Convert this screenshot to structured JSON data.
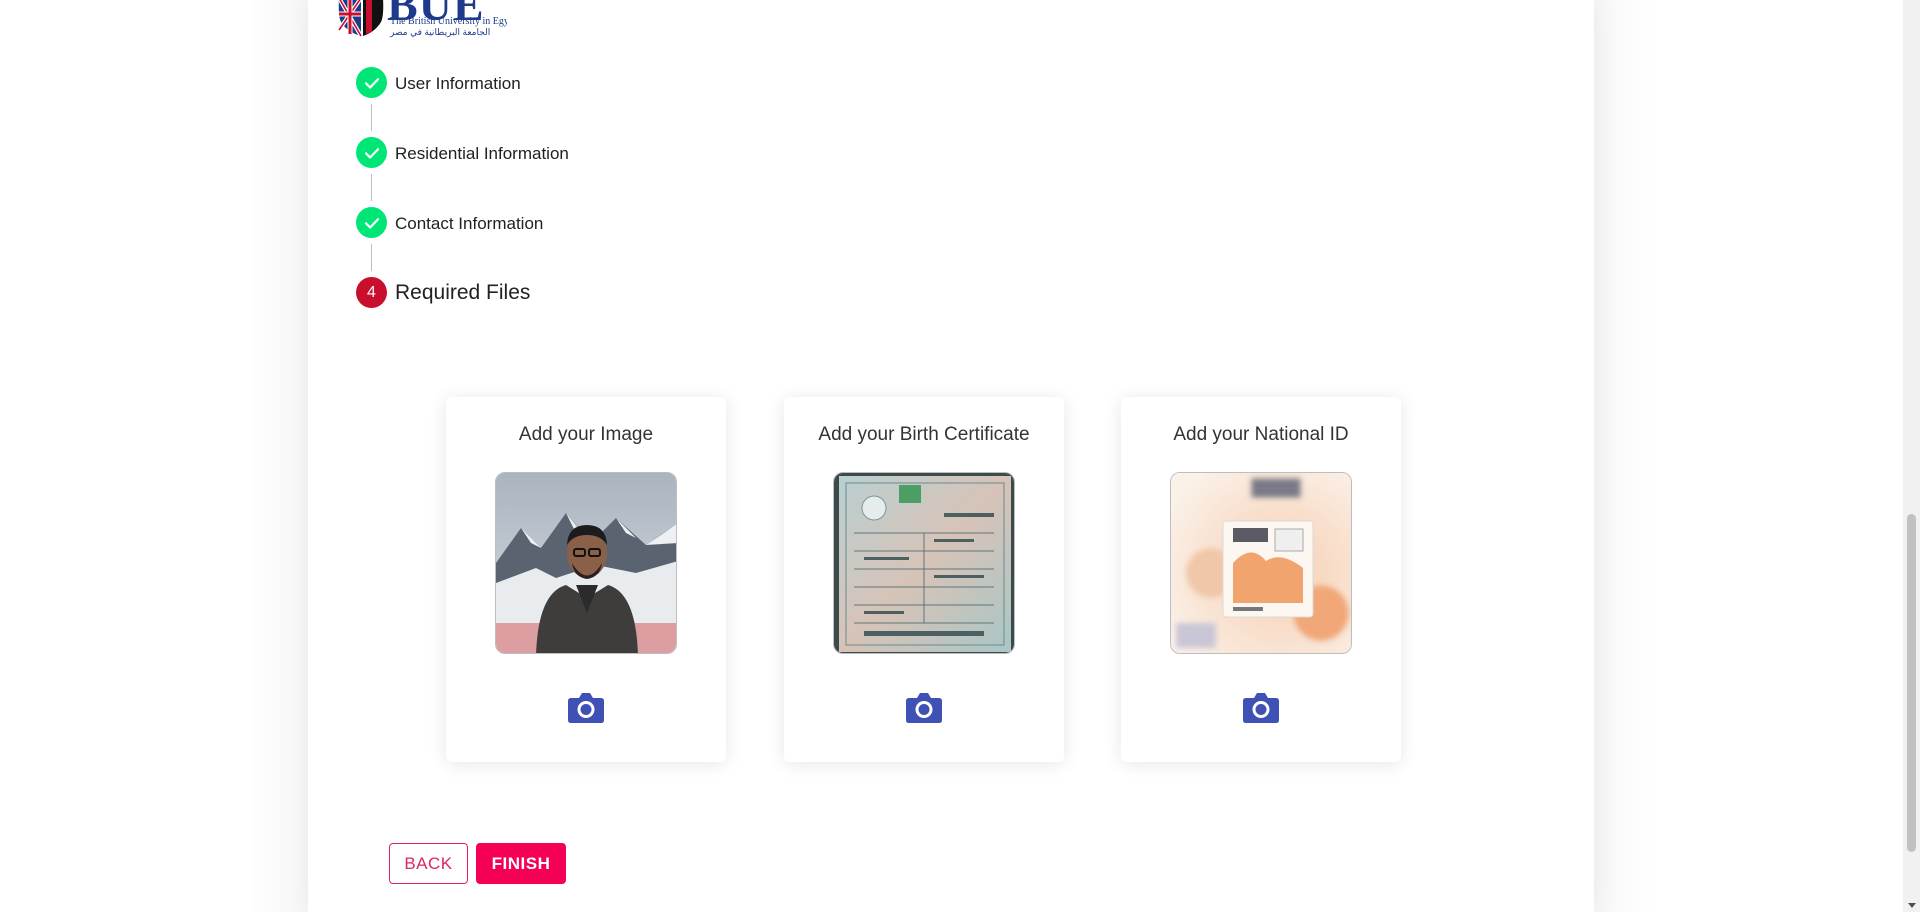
{
  "logo": {
    "name": "BUE",
    "english": "The British University in Egypt",
    "arabic": "الجامعة البريطانية في مصر"
  },
  "stepper": {
    "steps": [
      {
        "label": "User Information",
        "status": "completed",
        "icon": "check-icon"
      },
      {
        "label": "Residential Information",
        "status": "completed",
        "icon": "check-icon"
      },
      {
        "label": "Contact Information",
        "status": "completed",
        "icon": "check-icon"
      },
      {
        "label": "Required Files",
        "status": "active",
        "number": "4"
      }
    ]
  },
  "uploads": [
    {
      "title": "Add your Image",
      "preview": "profile-photo",
      "icon": "camera-icon"
    },
    {
      "title": "Add your Birth Certificate",
      "preview": "birth-certificate-photo",
      "icon": "camera-icon"
    },
    {
      "title": "Add your National ID",
      "preview": "national-id-photo",
      "icon": "camera-icon"
    }
  ],
  "actions": {
    "back_label": "BACK",
    "finish_label": "FINISH"
  },
  "colors": {
    "completed": "#00e676",
    "active_step": "#c8102e",
    "camera": "#3f51b5",
    "finish_bg": "#f50057",
    "back_border": "#e0246c"
  }
}
